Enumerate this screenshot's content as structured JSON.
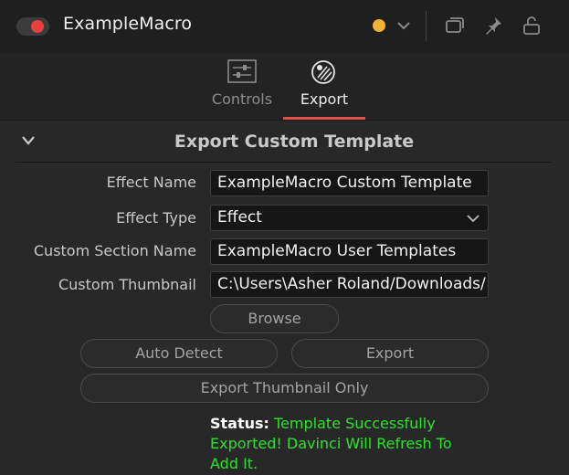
{
  "header": {
    "title": "ExampleMacro",
    "toggle_on_color": "#ea3e3e",
    "status_dot_color": "#f2b134",
    "icons": [
      "chevron-down-icon",
      "window-icon",
      "pin-icon",
      "lock-icon"
    ]
  },
  "tabs": [
    {
      "label": "Controls",
      "icon": "sliders-icon",
      "active": false
    },
    {
      "label": "Export",
      "icon": "palette-icon",
      "active": true
    }
  ],
  "accent_color": "#e0504a",
  "section": {
    "title": "Export Custom Template"
  },
  "form": {
    "effect_name": {
      "label": "Effect Name",
      "value": "ExampleMacro Custom Template"
    },
    "effect_type": {
      "label": "Effect Type",
      "value": "Effect"
    },
    "custom_section_name": {
      "label": "Custom Section Name",
      "value": "ExampleMacro User Templates"
    },
    "custom_thumbnail": {
      "label": "Custom Thumbnail",
      "value": "C:\\Users\\Asher Roland/Downloads/"
    }
  },
  "buttons": {
    "browse": "Browse",
    "auto_detect": "Auto Detect",
    "export": "Export",
    "export_thumbnail_only": "Export Thumbnail Only"
  },
  "status": {
    "label": "Status:",
    "message": "Template Successfully Exported! Davinci Will Refresh To Add It.",
    "message_color": "#2ee02e"
  }
}
